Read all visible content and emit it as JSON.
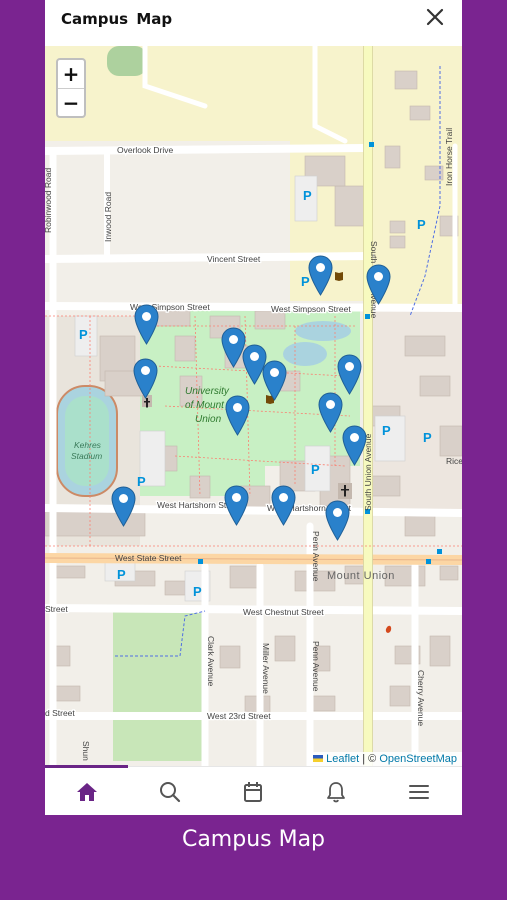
{
  "header": {
    "title": "Campus  Map"
  },
  "zoom": {
    "in_label": "+",
    "out_label": "−"
  },
  "attribution": {
    "leaflet": "Leaflet",
    "separator": " | © ",
    "osm": "OpenStreetMap"
  },
  "map_labels": {
    "overlook": "Overlook Drive",
    "vincent": "Vincent Street",
    "simpson_w": "West Simpson Street",
    "simpson_e": "West Simpson Street",
    "hartshorn_w": "West Hartshorn Street",
    "hartshorn_e": "West Hartshorn Street",
    "state": "West State Street",
    "chestnut": "West Chestnut Street",
    "chestnut_cut": "Street",
    "w23rd": "West 23rd Street",
    "w23rd_cut": "d Street",
    "robinwood": "Robinwood Road",
    "inwood": "Inwood Road",
    "south_union": "South Union Avenue",
    "iron_horse": "Iron Horse Trail",
    "clark": "Clark Avenue",
    "miller": "Miller Avenue",
    "penn": "Penn Avenue",
    "cherry": "Cherry Avenue",
    "rice": "Rice",
    "shun": "Shun",
    "univ1": "University",
    "univ2": "of Mount",
    "univ3": "Union",
    "kehres1": "Kehres",
    "kehres2": "Stadium",
    "mount_union": "Mount Union",
    "parking": "P"
  },
  "markers": [
    {
      "name": "campus-marker"
    },
    {
      "name": "campus-marker"
    },
    {
      "name": "campus-marker"
    },
    {
      "name": "campus-marker"
    },
    {
      "name": "campus-marker"
    },
    {
      "name": "campus-marker"
    },
    {
      "name": "campus-marker"
    },
    {
      "name": "campus-marker"
    },
    {
      "name": "campus-marker"
    },
    {
      "name": "campus-marker"
    },
    {
      "name": "campus-marker"
    },
    {
      "name": "campus-marker"
    },
    {
      "name": "campus-marker"
    },
    {
      "name": "campus-marker"
    },
    {
      "name": "campus-marker"
    },
    {
      "name": "campus-marker"
    }
  ],
  "tabs": [
    {
      "icon": "home-icon",
      "active": true
    },
    {
      "icon": "search-icon",
      "active": false
    },
    {
      "icon": "calendar-icon",
      "active": false
    },
    {
      "icon": "bell-icon",
      "active": false
    },
    {
      "icon": "menu-icon",
      "active": false
    }
  ],
  "caption": "Campus Map",
  "colors": {
    "frame": "#7a2490",
    "accent": "#6a2586",
    "marker": "#2a81cb",
    "campus_green": "#c8f0c4"
  }
}
